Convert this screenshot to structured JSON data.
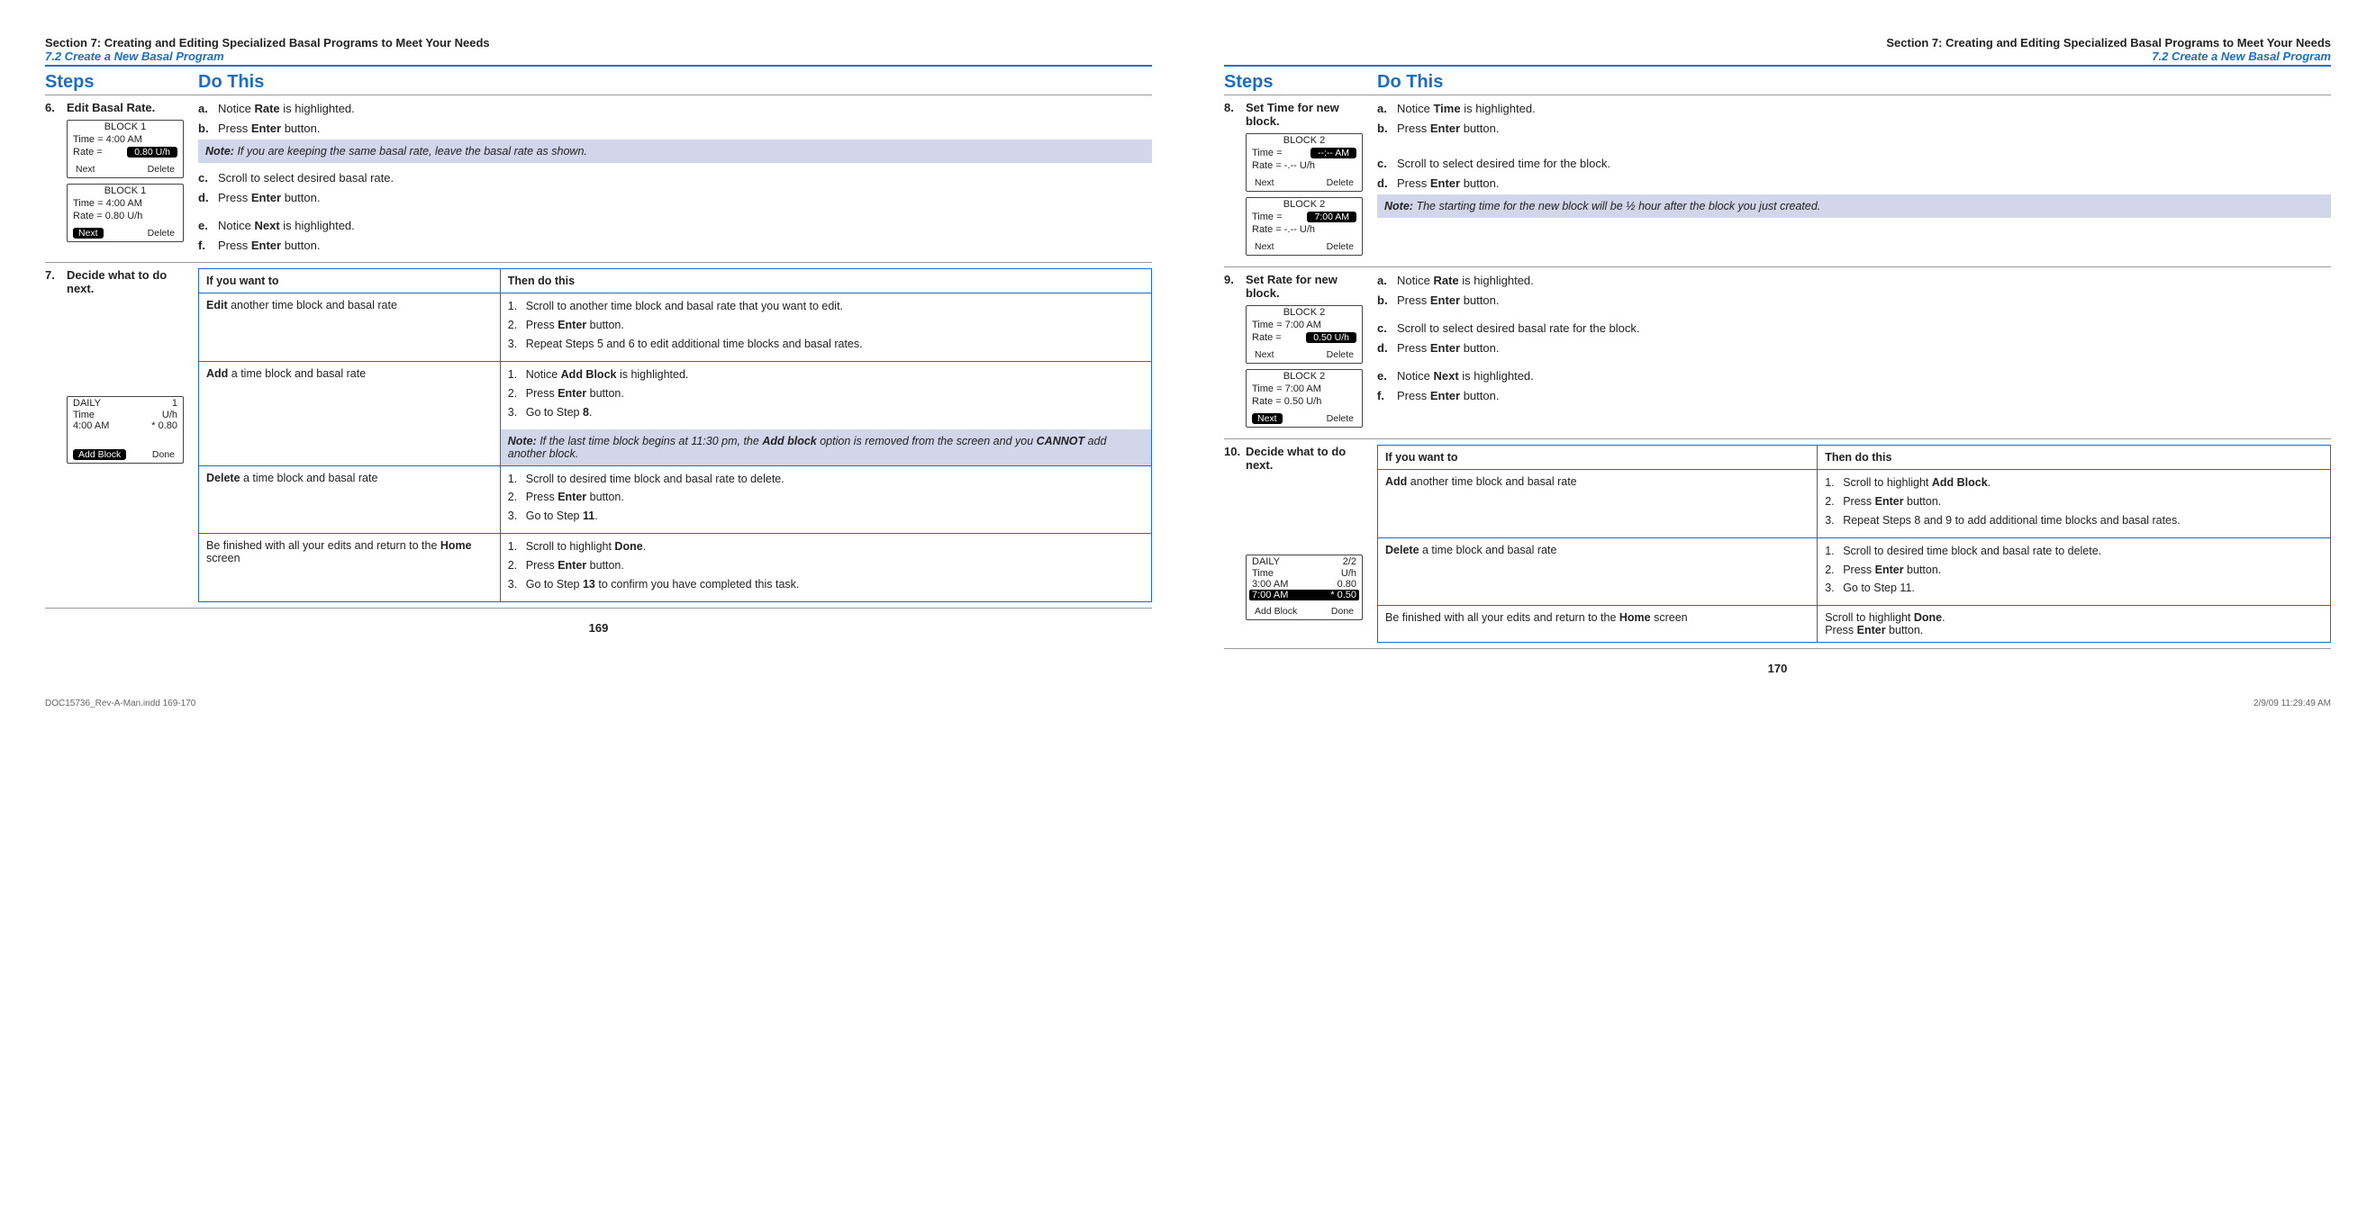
{
  "section_header": "Section 7: Creating and Editing Specialized Basal Programs to Meet Your Needs",
  "subsection": "7.2 Create a New Basal Program",
  "col_steps": "Steps",
  "col_dothis": "Do This",
  "left_page_num": "169",
  "right_page_num": "170",
  "footer_file": "DOC15736_Rev-A-Man.indd   169-170",
  "footer_stamp": "2/9/09   11:29:49 AM",
  "step6": {
    "num": "6.",
    "title": "Edit Basal Rate.",
    "a": "a.",
    "a_text_pre": "Notice ",
    "a_bold": "Rate",
    "a_text_post": " is highlighted.",
    "b": "b.",
    "b_text_pre": "Press ",
    "b_bold": "Enter",
    "b_text_post": " button.",
    "note": "If you are keeping the same basal rate, leave the basal rate as shown.",
    "c": "c.",
    "c_text": "Scroll to select desired basal rate.",
    "d": "d.",
    "d_text_pre": "Press ",
    "d_bold": "Enter",
    "d_text_post": " button.",
    "e": "e.",
    "e_text_pre": "Notice ",
    "e_bold": "Next",
    "e_text_post": " is highlighted.",
    "f": "f.",
    "f_text_pre": "Press ",
    "f_bold": "Enter",
    "f_text_post": " button.",
    "dev1": {
      "title": "BLOCK 1",
      "time": "Time = 4:00 AM",
      "rate_label": "Rate =",
      "rate_val": "0.80  U/h",
      "btn_l": "Next",
      "btn_r": "Delete"
    },
    "dev2": {
      "title": "BLOCK 1",
      "time": "Time = 4:00 AM",
      "rate": "Rate = 0.80 U/h",
      "btn_l": "Next",
      "btn_r": "Delete"
    }
  },
  "step7": {
    "num": "7.",
    "title": "Decide what to do next.",
    "th1": "If you want to",
    "th2": "Then do this",
    "r1c1_b": "Edit",
    "r1c1_rest": " another time block and basal rate",
    "r1_1": "Scroll to another time block and basal rate that you want to edit.",
    "r1_2_pre": "Press ",
    "r1_2_b": "Enter",
    "r1_2_post": " button.",
    "r1_3": "Repeat Steps 5 and 6 to edit additional time blocks and basal rates.",
    "r2c1_b": "Add",
    "r2c1_rest": " a time block and basal rate",
    "r2_1_pre": "Notice ",
    "r2_1_b": "Add Block",
    "r2_1_post": " is highlighted.",
    "r2_2_pre": "Press ",
    "r2_2_b": "Enter",
    "r2_2_post": " button.",
    "r2_3_pre": "Go to Step ",
    "r2_3_b": "8",
    "r2_3_post": ".",
    "r2_note_pre": "If the last time block begins at 11:30 pm, the ",
    "r2_note_b": "Add block",
    "r2_note_mid": " option is removed from the screen and you ",
    "r2_note_b2": "CANNOT",
    "r2_note_post": " add another block.",
    "r3c1_b": "Delete",
    "r3c1_rest": " a time block and basal rate",
    "r3_1": "Scroll to desired time block and basal rate to delete.",
    "r3_2_pre": "Press ",
    "r3_2_b": "Enter",
    "r3_2_post": " button.",
    "r3_3_pre": "Go to Step ",
    "r3_3_b": "11",
    "r3_3_post": ".",
    "r4c1_pre": "Be finished with all your edits and return to the ",
    "r4c1_b": "Home",
    "r4c1_post": " screen",
    "r4_1_pre": "Scroll to highlight ",
    "r4_1_b": "Done",
    "r4_1_post": ".",
    "r4_2_pre": "Press ",
    "r4_2_b": "Enter",
    "r4_2_post": " button.",
    "r4_3_pre": "Go to Step ",
    "r4_3_b": "13",
    "r4_3_post": " to confirm you have completed this task.",
    "dev": {
      "title": "DAILY",
      "title_r": "1",
      "h1": "Time",
      "h2": "U/h",
      "row_t": "4:00 AM",
      "row_v": "* 0.80",
      "btn_l": "Add Block",
      "btn_r": "Done"
    }
  },
  "step8": {
    "num": "8.",
    "title": "Set Time for new block.",
    "a": "a.",
    "a_pre": "Notice ",
    "a_b": "Time",
    "a_post": " is highlighted.",
    "b": "b.",
    "b_pre": "Press ",
    "b_b": "Enter",
    "b_post": " button.",
    "c": "c.",
    "c_text": "Scroll to select desired time for the block.",
    "d": "d.",
    "d_pre": "Press ",
    "d_b": "Enter",
    "d_post": " button.",
    "note": "The starting time for the new block will be ½ hour after the block you just created.",
    "dev1": {
      "title": "BLOCK 2",
      "time_label": "Time =",
      "time_val": "--:--  AM",
      "rate": "Rate = -.-- U/h",
      "btn_l": "Next",
      "btn_r": "Delete"
    },
    "dev2": {
      "title": "BLOCK 2",
      "time_label": "Time =",
      "time_val": "7:00  AM",
      "rate": "Rate = -.-- U/h",
      "btn_l": "Next",
      "btn_r": "Delete"
    }
  },
  "step9": {
    "num": "9.",
    "title": "Set Rate for new block.",
    "a": "a.",
    "a_pre": "Notice ",
    "a_b": "Rate",
    "a_post": " is highlighted.",
    "b": "b.",
    "b_pre": "Press ",
    "b_b": "Enter",
    "b_post": " button.",
    "c": "c.",
    "c_text": "Scroll to select desired basal rate for the block.",
    "d": "d.",
    "d_pre": "Press ",
    "d_b": "Enter",
    "d_post": " button.",
    "e": "e.",
    "e_pre": "Notice ",
    "e_b": "Next",
    "e_post": " is highlighted.",
    "f": "f.",
    "f_pre": "Press ",
    "f_b": "Enter",
    "f_post": " button.",
    "dev1": {
      "title": "BLOCK 2",
      "time": "Time = 7:00 AM",
      "rate_label": "Rate =",
      "rate_val": "0.50  U/h",
      "btn_l": "Next",
      "btn_r": "Delete"
    },
    "dev2": {
      "title": "BLOCK 2",
      "time": "Time = 7:00 AM",
      "rate": "Rate = 0.50 U/h",
      "btn_l": "Next",
      "btn_r": "Delete"
    }
  },
  "step10": {
    "num": "10.",
    "title": "Decide what to do next.",
    "th1": "If you want to",
    "th2": "Then do this",
    "r1c1_b": "Add",
    "r1c1_rest": " another time block and basal rate",
    "r1_1_pre": "Scroll to highlight ",
    "r1_1_b": "Add Block",
    "r1_1_post": ".",
    "r1_2_pre": "Press ",
    "r1_2_b": "Enter",
    "r1_2_post": " button.",
    "r1_3": "Repeat Steps 8 and 9 to add additional time blocks and basal rates.",
    "r2c1_b": "Delete",
    "r2c1_rest": " a time block and basal rate",
    "r2_1": "Scroll to desired time block and basal rate to delete.",
    "r2_2_pre": "Press ",
    "r2_2_b": "Enter",
    "r2_2_post": " button.",
    "r2_3": "Go to Step 11.",
    "r3c1_pre": "Be finished with all your edits and return to the ",
    "r3c1_b": "Home",
    "r3c1_post": " screen",
    "r3_1_pre": "Scroll to highlight ",
    "r3_1_b": "Done",
    "r3_1_post": ".",
    "r3_2_pre": "Press ",
    "r3_2_b": "Enter",
    "r3_2_post": " button.",
    "dev": {
      "title": "DAILY",
      "title_r": "2/2",
      "h1": "Time",
      "h2": "U/h",
      "row1_t": "3:00 AM",
      "row1_v": "0.80",
      "row2_t": "7:00 AM",
      "row2_v": "* 0.50",
      "btn_l": "Add Block",
      "btn_r": "Done"
    }
  },
  "note_label": "Note:"
}
